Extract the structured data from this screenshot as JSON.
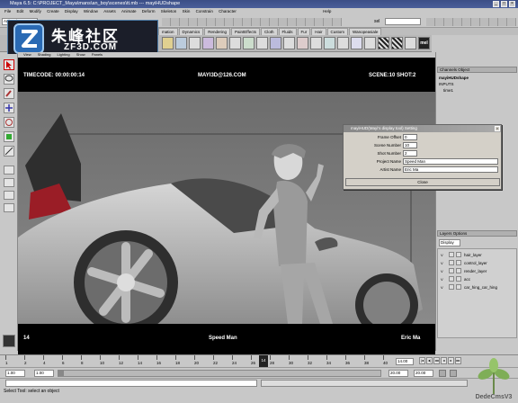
{
  "window": {
    "title": "Maya 6.5: C:\\PROJECT_Maya\\mans\\an_boy\\scenes\\tt.mb --- mayiHUDshape",
    "controls": [
      "_",
      "□",
      "×"
    ]
  },
  "menubar": {
    "items": [
      "File",
      "Edit",
      "Modify",
      "Create",
      "Display",
      "Window",
      "Assets",
      "Animate",
      "Deform",
      "Skeleton",
      "Skin",
      "Constrain",
      "Character",
      "",
      "",
      "",
      "",
      "",
      "Help"
    ]
  },
  "statusline": {
    "mode": "Animation",
    "sel_label": "sel"
  },
  "shelf": {
    "tabs": [
      "mation",
      "Dynamics",
      "Rendering",
      "PaintEffects",
      "Cloth",
      "Fluids",
      "Fur",
      "Hair",
      "Custom",
      "Wanopeasiale"
    ],
    "icon_labels": [
      "mel"
    ]
  },
  "logo": {
    "cn": "朱峰社区",
    "en": "ZF3D.COM"
  },
  "viewport": {
    "panel_menu": [
      "View",
      "Shading",
      "Lighting",
      "Show",
      "Panels"
    ],
    "hud": {
      "timecode": "TIMECODE: 00:00:00:14",
      "email": "MAYI3D@126.COM",
      "scene_shot": "SCENE:10 SHOT:2",
      "frame": "14",
      "project": "Speed Man",
      "artist": "Eric Ma"
    }
  },
  "dialog": {
    "title": "mayiHUD(Mayi's display tool) Setting",
    "close_glyph": "×",
    "fields": [
      {
        "label": "Frame Offset",
        "value": "0"
      },
      {
        "label": "Scene Number",
        "value": "10"
      },
      {
        "label": "Shot Number",
        "value": "2"
      },
      {
        "label": "Project Name",
        "value": "Speed Man"
      },
      {
        "label": "Artist Name",
        "value": "Eric Ma"
      }
    ],
    "close_label": "Close"
  },
  "channel_box": {
    "header": "Channels Object",
    "object": "mayiHUDshape",
    "inputs_label": "INPUTS",
    "input": "time1"
  },
  "layers": {
    "header": "Layers Options",
    "mode": "Display",
    "items": [
      {
        "visible": "V",
        "name": "hair_layer"
      },
      {
        "visible": "V",
        "name": "control_layer"
      },
      {
        "visible": "V",
        "name": "render_layer"
      },
      {
        "visible": "V",
        "name": "acc"
      },
      {
        "visible": "V",
        "name": "car_hing_car_hing"
      }
    ]
  },
  "timeslider": {
    "ticks": [
      "1",
      "2",
      "4",
      "6",
      "8",
      "10",
      "12",
      "14",
      "16",
      "18",
      "20",
      "22",
      "24",
      "26",
      "28",
      "30",
      "32",
      "34",
      "36",
      "38",
      "40"
    ],
    "current_frame": "14",
    "current_field": "14.00"
  },
  "range": {
    "start": "1.00",
    "start_inner": "1.00",
    "end_inner": "20.00",
    "end": "20.00"
  },
  "helpline": {
    "text": "Select Tool: select an object"
  },
  "watermark": {
    "text": "DedeCmsV3"
  }
}
